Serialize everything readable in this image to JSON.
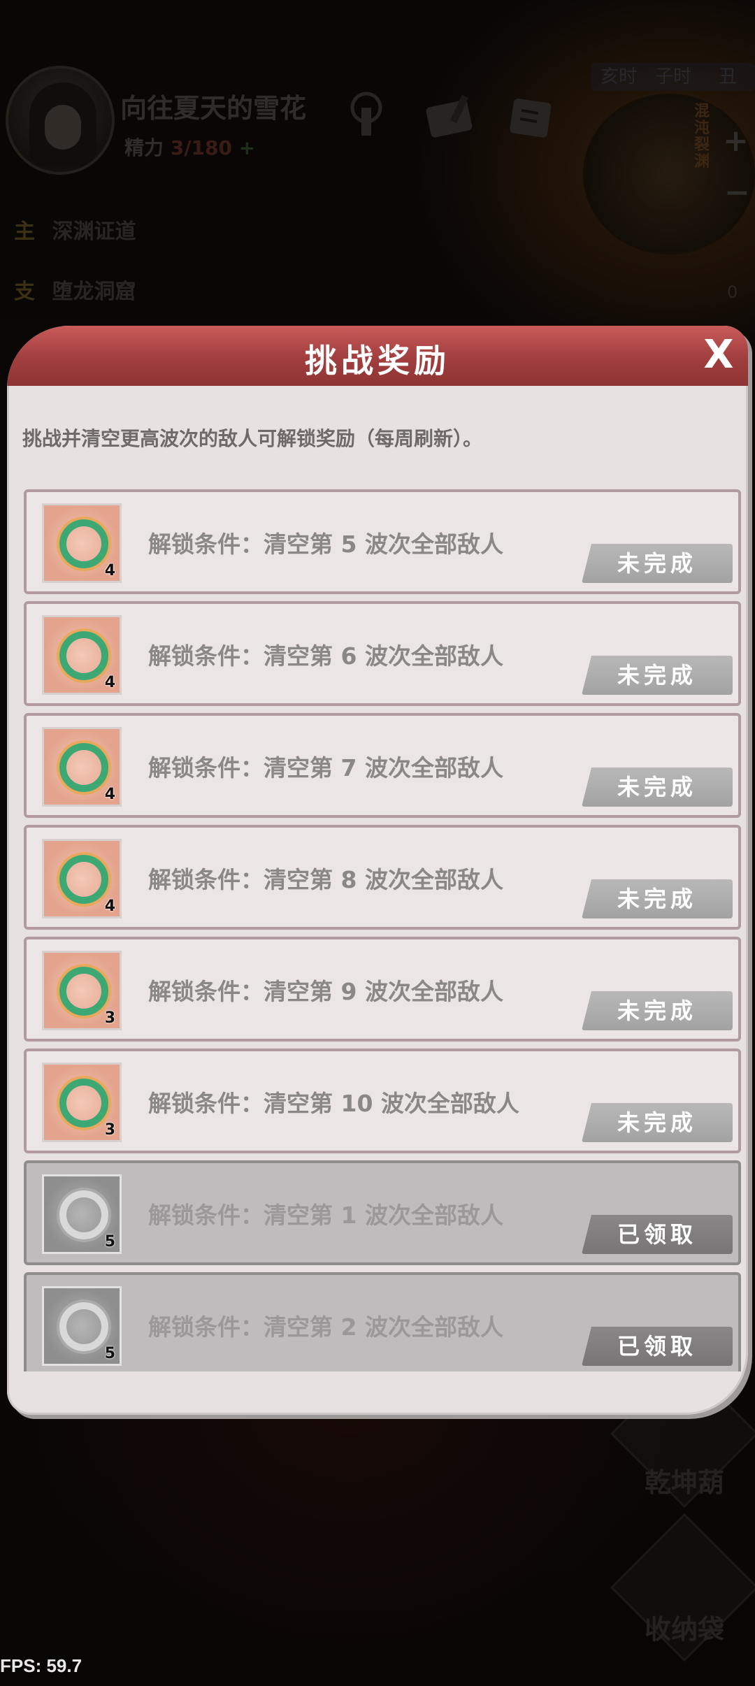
{
  "hud": {
    "player_name": "向往夏天的雪花",
    "energy_label": "精力",
    "energy_value": "3/180",
    "energy_plus": "+",
    "time_labels": [
      "亥时",
      "子时",
      "丑"
    ],
    "minimap_label": "混沌裂渊",
    "zoom_in": "+",
    "zoom_out": "−",
    "quests": [
      {
        "tag": "主",
        "name": "深渊证道"
      },
      {
        "tag": "支",
        "name": "堕龙洞窟"
      }
    ],
    "counter": "0",
    "side_buttons": [
      {
        "label": "乾坤葫"
      },
      {
        "label": "收纳袋"
      }
    ],
    "fps": "FPS: 59.7"
  },
  "dialog": {
    "title": "挑战奖励",
    "close_label": "X",
    "description": "挑战并清空更高波次的敌人可解锁奖励（每周刷新）。",
    "rows": [
      {
        "count": "4",
        "condition": "解锁条件：清空第 5 波次全部敌人",
        "status": "未完成",
        "claimed": false
      },
      {
        "count": "4",
        "condition": "解锁条件：清空第 6 波次全部敌人",
        "status": "未完成",
        "claimed": false
      },
      {
        "count": "4",
        "condition": "解锁条件：清空第 7 波次全部敌人",
        "status": "未完成",
        "claimed": false
      },
      {
        "count": "4",
        "condition": "解锁条件：清空第 8 波次全部敌人",
        "status": "未完成",
        "claimed": false
      },
      {
        "count": "3",
        "condition": "解锁条件：清空第 9 波次全部敌人",
        "status": "未完成",
        "claimed": false
      },
      {
        "count": "3",
        "condition": "解锁条件：清空第 10 波次全部敌人",
        "status": "未完成",
        "claimed": false
      },
      {
        "count": "5",
        "condition": "解锁条件：清空第 1 波次全部敌人",
        "status": "已领取",
        "claimed": true
      },
      {
        "count": "5",
        "condition": "解锁条件：清空第 2 波次全部敌人",
        "status": "已领取",
        "claimed": true
      }
    ]
  }
}
